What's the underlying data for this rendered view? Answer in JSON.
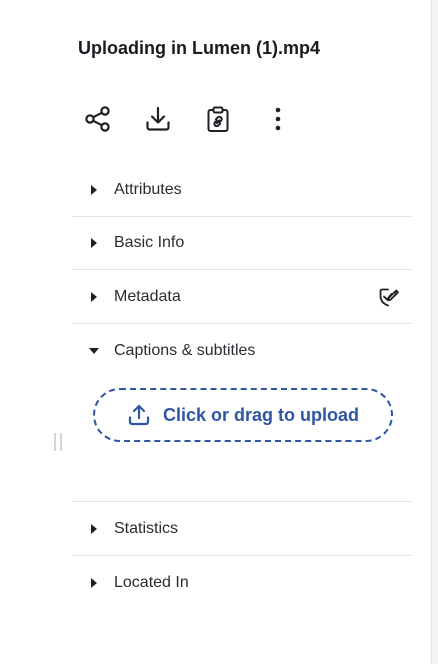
{
  "panel": {
    "title": "Uploading in Lumen (1).mp4"
  },
  "toolbar": {
    "actions": [
      {
        "name": "share",
        "icon": "share-icon"
      },
      {
        "name": "download",
        "icon": "download-icon"
      },
      {
        "name": "copy-link",
        "icon": "clipboard-link-icon"
      },
      {
        "name": "more",
        "icon": "more-vertical-icon"
      }
    ]
  },
  "sections": [
    {
      "label": "Attributes",
      "expanded": false
    },
    {
      "label": "Basic Info",
      "expanded": false
    },
    {
      "label": "Metadata",
      "expanded": false,
      "extra_icon": "edit-badge-icon"
    },
    {
      "label": "Captions & subtitles",
      "expanded": true
    },
    {
      "label": "Statistics",
      "expanded": false
    },
    {
      "label": "Located In",
      "expanded": false
    }
  ],
  "captions": {
    "upload_label": "Click or drag to upload"
  },
  "colors": {
    "accent": "#2f56a3",
    "text": "#1f2126",
    "divider": "#e2e3e7"
  }
}
